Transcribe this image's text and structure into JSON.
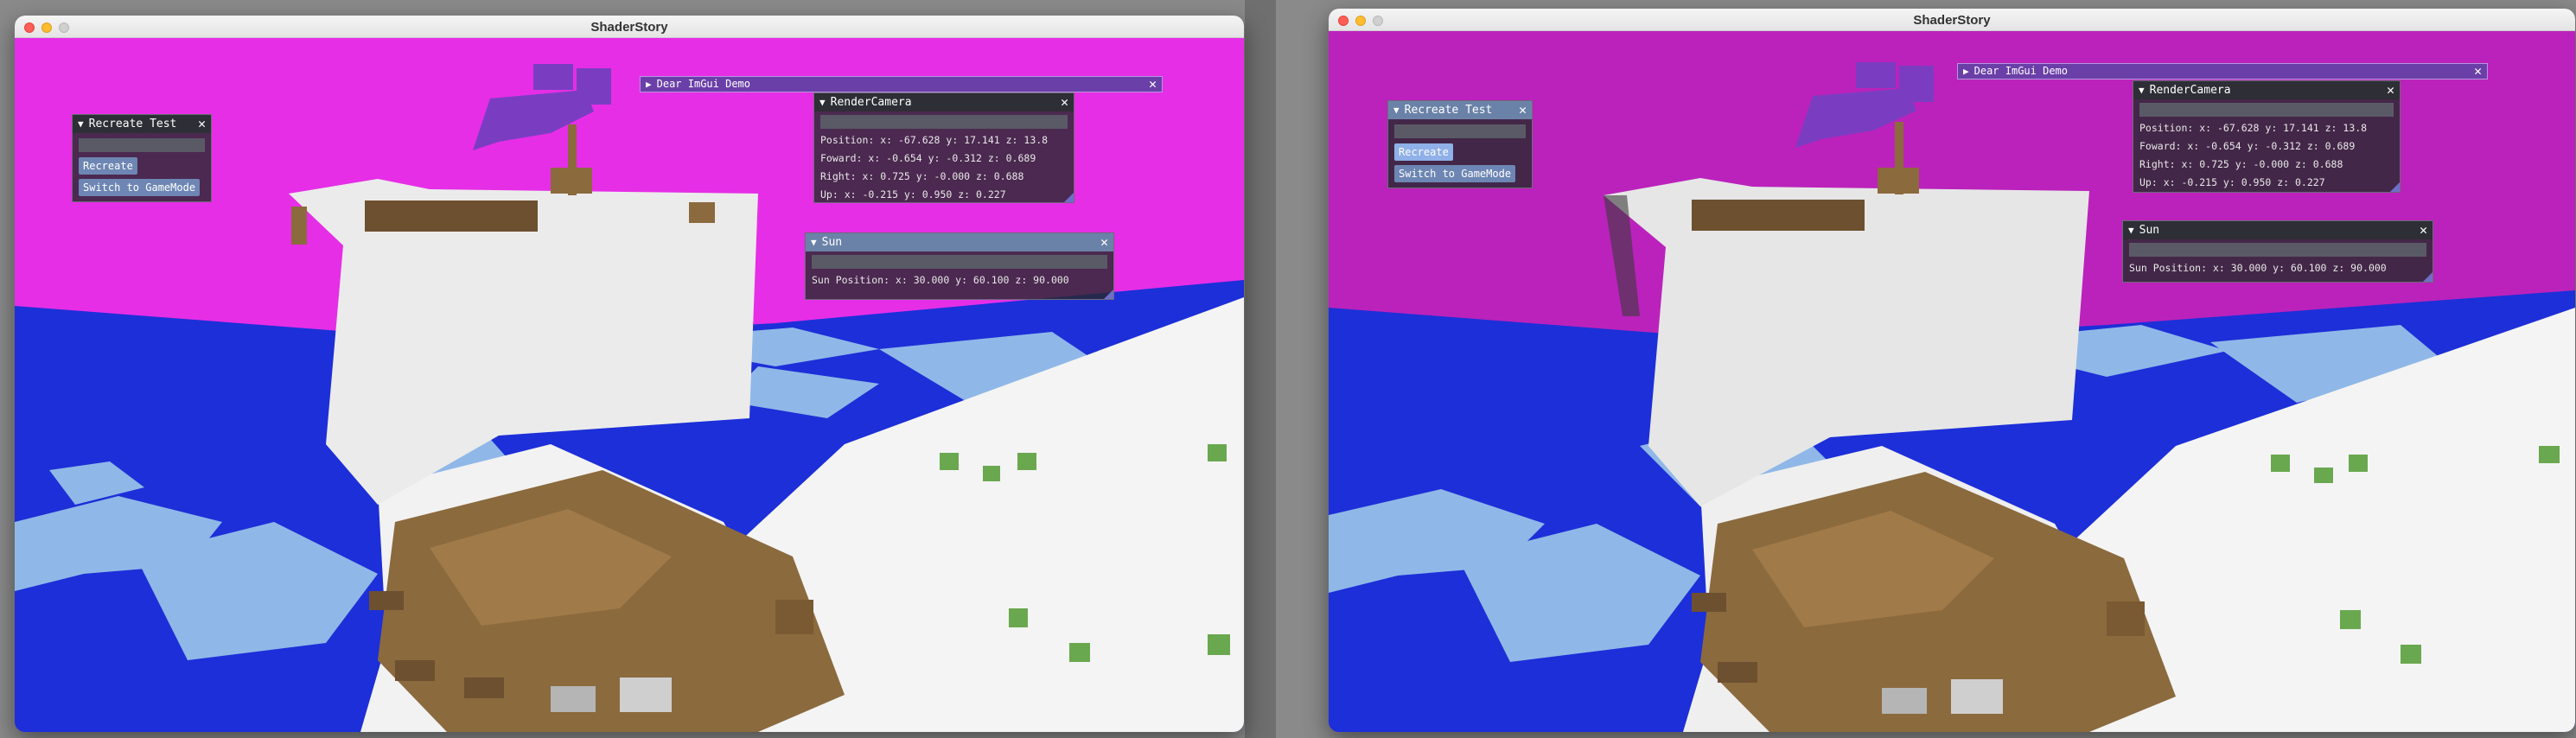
{
  "window_title": "ShaderStory",
  "panels": {
    "recreate": {
      "title": "Recreate Test",
      "buttons": [
        "Recreate",
        "Switch to GameMode"
      ]
    },
    "demo": {
      "title": "Dear ImGui Demo"
    },
    "camera": {
      "title": "RenderCamera",
      "lines": [
        "Position: x: -67.628 y: 17.141 z: 13.8",
        "Foward: x: -0.654 y: -0.312 z: 0.689",
        "Right: x: 0.725 y: -0.000 z: 0.688",
        "Up: x: -0.215 y: 0.950 z: 0.227"
      ]
    },
    "sun": {
      "title": "Sun",
      "line": "Sun Position: x: 30.000 y: 60.100 z: 90.000"
    }
  },
  "colors": {
    "sky_left": "#e62ee6",
    "sky_right": "#bb22bb",
    "water_deep": "#1d2fd8",
    "water_light": "#8fb8e8",
    "snow": "#f4f4f4",
    "wood": "#8b6a3e",
    "sail": "#e9e9e9",
    "flag": "#7a3dc2",
    "grass": "#6aa84f"
  },
  "icons": [
    "close-icon",
    "collapse-triangle-icon"
  ]
}
